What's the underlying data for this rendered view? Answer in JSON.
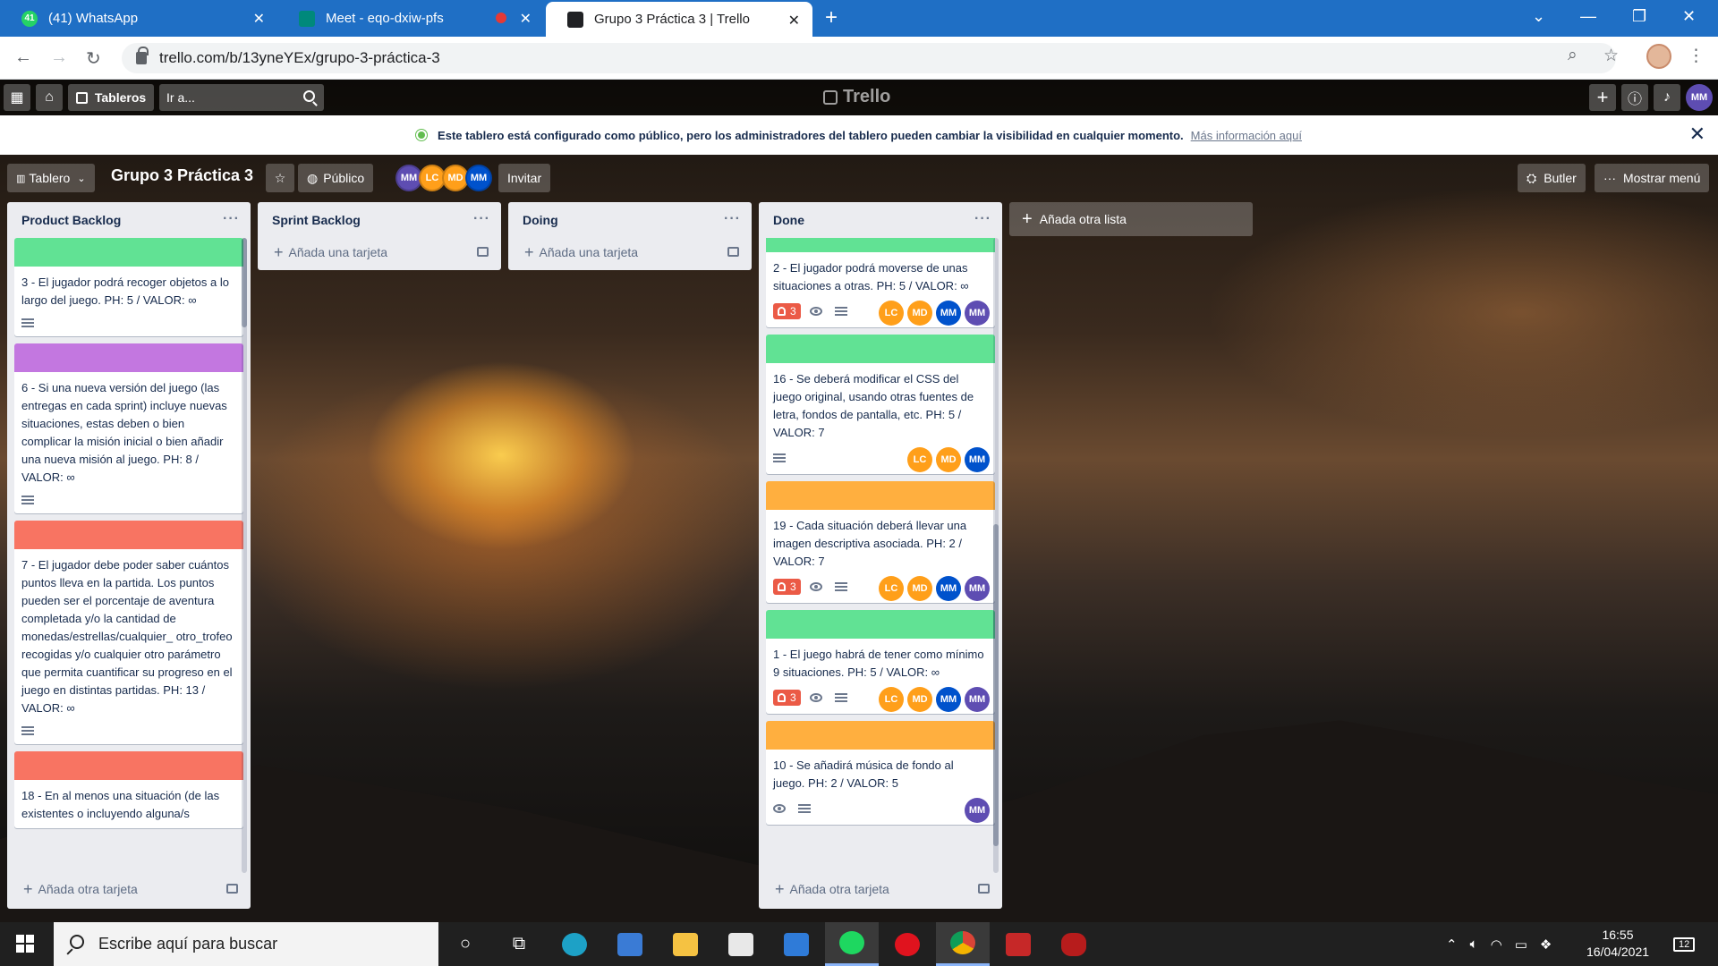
{
  "browser": {
    "tabs": [
      {
        "title": "(41) WhatsApp",
        "favicon": "whatsapp-icon",
        "badge": "41",
        "color": "#25d366"
      },
      {
        "title": "Meet - eqo-dxiw-pfs",
        "favicon": "meet-icon",
        "color": "#00897b"
      },
      {
        "title": "Grupo 3 Práctica 3 | Trello",
        "favicon": "trello-icon",
        "color": "#0079bf"
      }
    ],
    "url": "trello.com/b/13yneYEx/grupo-3-práctica-3"
  },
  "trello_header": {
    "tableros_label": "Tableros",
    "search_placeholder": "Ir a...",
    "logo_text": "Trello",
    "user_initials": "MM"
  },
  "banner": {
    "text": "Este tablero está configurado como público, pero los administradores del tablero pueden cambiar la visibilidad en cualquier momento.",
    "link": "Más información aquí"
  },
  "board": {
    "view_label": "Tablero",
    "title": "Grupo 3 Práctica 3",
    "visibility": "Público",
    "invite_label": "Invitar",
    "butler_label": "Butler",
    "menu_label": "Mostrar menú",
    "members": [
      {
        "initials": "MM",
        "color": "#5e4db2"
      },
      {
        "initials": "LC",
        "color": "#ff9f1a"
      },
      {
        "initials": "MD",
        "color": "#ff9f1a"
      },
      {
        "initials": "MM",
        "color": "#0052cc"
      }
    ],
    "add_list_label": "Añada otra lista"
  },
  "lists": [
    {
      "title": "Product Backlog",
      "add_card": "Añada otra tarjeta",
      "cards": [
        {
          "cover": "#61e294",
          "text": "3 - El jugador podrá recoger objetos a lo largo del juego. PH: 5 / VALOR: ∞"
        },
        {
          "cover": "#c377e0",
          "text": "6 - Si una nueva versión del juego (las entregas en cada sprint) incluye nuevas situaciones, estas deben o bien complicar la misión inicial o bien añadir una nueva misión al juego. PH: 8 / VALOR: ∞"
        },
        {
          "cover": "#f87462",
          "text": "7 - El jugador debe poder saber cuántos puntos lleva en la partida. Los puntos pueden ser el porcentaje de aventura completada y/o la cantidad de monedas/estrellas/cualquier_ otro_trofeo recogidas y/o cualquier otro parámetro que permita cuantificar su progreso en el juego en distintas partidas. PH: 13 / VALOR: ∞"
        },
        {
          "cover": "#f87462",
          "text": "18 - En al menos una situación (de las existentes o incluyendo alguna/s"
        }
      ]
    },
    {
      "title": "Sprint Backlog",
      "add_card": "Añada una tarjeta"
    },
    {
      "title": "Doing",
      "add_card": "Añada una tarjeta"
    },
    {
      "title": "Done",
      "add_card": "Añada otra tarjeta",
      "cards": [
        {
          "cover": "#61e294",
          "text": "2 - El jugador podrá moverse de unas situaciones a otras. PH: 5 / VALOR: ∞",
          "due": "3",
          "members": [
            "LC",
            "MD",
            "MM",
            "MM"
          ]
        },
        {
          "cover": "#61e294",
          "text": "16 - Se deberá modificar el CSS del juego original, usando otras fuentes de letra, fondos de pantalla, etc. PH: 5 / VALOR: 7",
          "members": [
            "LC",
            "MD",
            "MM"
          ]
        },
        {
          "cover": "#ffaf3f",
          "text": "19 - Cada situación deberá llevar una imagen descriptiva asociada. PH: 2 / VALOR: 7",
          "due": "3",
          "members": [
            "LC",
            "MD",
            "MM",
            "MM"
          ]
        },
        {
          "cover": "#61e294",
          "text": "1 - El juego habrá de tener como mínimo 9 situaciones. PH: 5 / VALOR: ∞",
          "due": "3",
          "members": [
            "LC",
            "MD",
            "MM",
            "MM"
          ]
        },
        {
          "cover": "#ffaf3f",
          "text": "10 - Se añadirá música de fondo al juego. PH: 2 / VALOR: 5",
          "members": [
            "MM"
          ]
        }
      ]
    }
  ],
  "taskbar": {
    "search_placeholder": "Escribe aquí para buscar",
    "time": "16:55",
    "date": "16/04/2021",
    "notifications": "12"
  }
}
